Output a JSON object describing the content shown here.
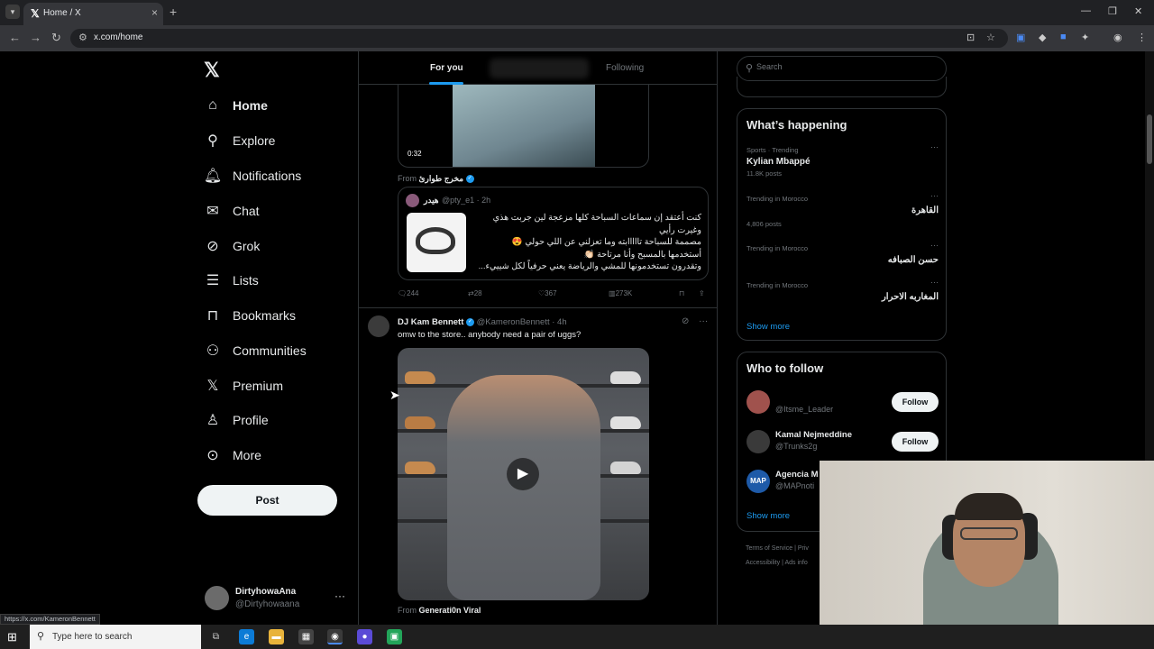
{
  "browser": {
    "tab_title": "Home / X",
    "url": "x.com/home",
    "status_url": "https://x.com/KameronBennett"
  },
  "sidebar": {
    "items": [
      {
        "label": "Home",
        "icon": "home-icon"
      },
      {
        "label": "Explore",
        "icon": "search-icon"
      },
      {
        "label": "Notifications",
        "icon": "bell-icon"
      },
      {
        "label": "Chat",
        "icon": "mail-icon"
      },
      {
        "label": "Grok",
        "icon": "grok-icon"
      },
      {
        "label": "Lists",
        "icon": "list-icon"
      },
      {
        "label": "Bookmarks",
        "icon": "bookmark-icon"
      },
      {
        "label": "Communities",
        "icon": "people-icon"
      },
      {
        "label": "Premium",
        "icon": "x-icon"
      },
      {
        "label": "Profile",
        "icon": "person-icon"
      },
      {
        "label": "More",
        "icon": "more-circle-icon"
      }
    ],
    "post_label": "Post",
    "account": {
      "name": "DirtyhowaAna",
      "handle": "@Dirtyhowaana"
    }
  },
  "feed": {
    "tabs": {
      "for_you": "For you",
      "following": "Following"
    },
    "tweet1": {
      "video_duration": "0:32",
      "from_label": "From",
      "from_name": "مخرج طوارئ",
      "quote": {
        "name": "هيدر",
        "handle": "@pty_e1 · 2h",
        "text": [
          "كنت أعتقد إن سماعات السباحة كلها مزعجة لين جربت هذي",
          "وغيرت رأيي",
          "مصممة للسباحة تااااابته وما تعزلني عن اللي حولي 😍",
          "أستخدمها بالمسبح وأنا مرتاحة 👏🏻",
          "وتقدرون تستخدمونها للمشي والرياضة يعني حرفياً لكل شيييء..."
        ]
      },
      "actions": {
        "replies": "244",
        "reposts": "28",
        "likes": "367",
        "views": "273K"
      }
    },
    "tweet2": {
      "name": "DJ Kam Bennett",
      "handle": "@KameronBennett · 4h",
      "text": "omw to the store.. anybody need a pair of uggs?",
      "from_label": "From",
      "from_name": "Generati0n Viral"
    }
  },
  "right": {
    "search_placeholder": "Search",
    "happening_title": "What’s happening",
    "trends": [
      {
        "meta": "Sports · Trending",
        "topic": "Kylian Mbappé",
        "count": "11.8K posts"
      },
      {
        "meta": "Trending in Morocco",
        "topic": "القاهرة",
        "count": "4,806 posts"
      },
      {
        "meta": "Trending in Morocco",
        "topic": "حسن الصبافه",
        "count": ""
      },
      {
        "meta": "Trending in Morocco",
        "topic": "المغاربه الاحرار",
        "count": ""
      }
    ],
    "show_more": "Show more",
    "who_title": "Who to follow",
    "who": [
      {
        "name": "",
        "handle": "@Itsme_Leader",
        "follow": "Follow",
        "avatar_color": "#a0524d"
      },
      {
        "name": "Kamal Nejmeddine",
        "handle": "@Trunks2g",
        "follow": "Follow",
        "avatar_color": "#3a3a3a"
      },
      {
        "name": "Agencia M",
        "handle": "@MAPnoti",
        "follow": "",
        "avatar_color": "#1e5aa8",
        "avatar_text": "MAP"
      }
    ],
    "show_more_2": "Show more",
    "footer": {
      "line1": "Terms of Service  |  Priv",
      "line2": "Accessibility  |  Ads info"
    }
  },
  "taskbar": {
    "search_placeholder": "Type here to search"
  }
}
